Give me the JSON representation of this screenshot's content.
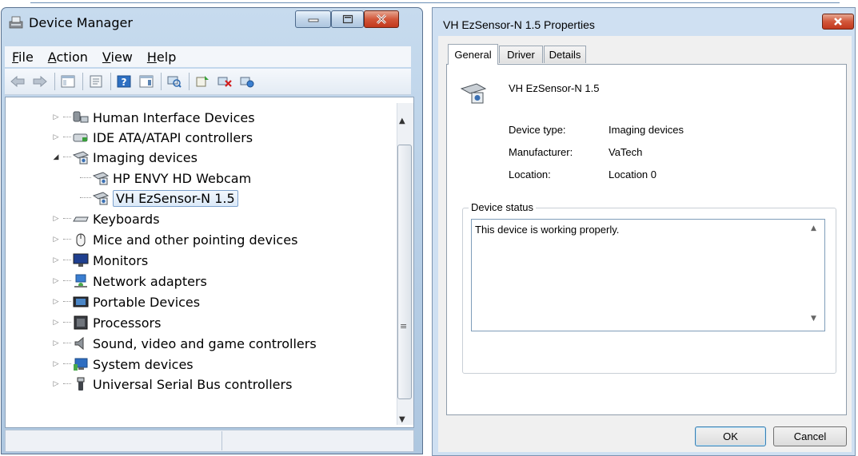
{
  "device_manager": {
    "title": "Device Manager",
    "menu": [
      {
        "label": "File"
      },
      {
        "label": "Action"
      },
      {
        "label": "View"
      },
      {
        "label": "Help"
      }
    ],
    "tree": [
      {
        "label": "Human Interface Devices",
        "icon": "hid-icon"
      },
      {
        "label": "IDE ATA/ATAPI controllers",
        "icon": "ide-controller-icon"
      },
      {
        "label": "Imaging devices",
        "icon": "camera-icon"
      },
      {
        "label": "HP ENVY HD Webcam",
        "icon": "camera-icon"
      },
      {
        "label": "VH EzSensor-N 1.5",
        "icon": "camera-icon"
      },
      {
        "label": "Keyboards",
        "icon": "keyboard-icon"
      },
      {
        "label": "Mice and other pointing devices",
        "icon": "mouse-icon"
      },
      {
        "label": "Monitors",
        "icon": "monitor-icon"
      },
      {
        "label": "Network adapters",
        "icon": "network-icon"
      },
      {
        "label": "Portable Devices",
        "icon": "portable-device-icon"
      },
      {
        "label": "Processors",
        "icon": "processor-icon"
      },
      {
        "label": "Sound, video and game controllers",
        "icon": "speaker-icon"
      },
      {
        "label": "System devices",
        "icon": "system-icon"
      },
      {
        "label": "Universal Serial Bus controllers",
        "icon": "usb-icon"
      }
    ]
  },
  "properties": {
    "title": "VH EzSensor-N 1.5 Properties",
    "tabs": [
      "General",
      "Driver",
      "Details"
    ],
    "device_name": "VH EzSensor-N 1.5",
    "fields": [
      {
        "label": "Device type:",
        "value": "Imaging devices"
      },
      {
        "label": "Manufacturer:",
        "value": "VaTech"
      },
      {
        "label": "Location:",
        "value": "Location 0"
      }
    ],
    "status_legend": "Device status",
    "status_text": "This device is working properly.",
    "ok_label": "OK",
    "cancel_label": "Cancel"
  }
}
